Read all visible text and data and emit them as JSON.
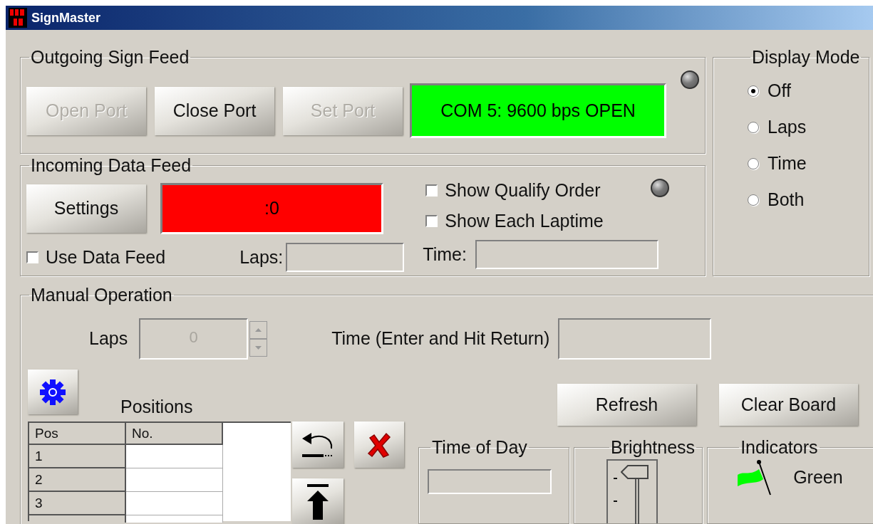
{
  "window": {
    "title": "SignMaster"
  },
  "outgoing_sign_feed": {
    "title": "Outgoing Sign Feed",
    "buttons": [
      {
        "label": "Open Port",
        "disabled": true
      },
      {
        "label": "Close Port",
        "disabled": false
      },
      {
        "label": "Set Port",
        "disabled": true
      }
    ],
    "status": {
      "text": "COM 5: 9600 bps OPEN",
      "alert": false
    },
    "led_lit": false
  },
  "incoming_data_feed": {
    "title": "Incoming Data Feed",
    "settings_button": "Settings",
    "status": {
      "text": ":0",
      "alert": true
    },
    "led_lit": false,
    "checkboxes": [
      {
        "label": "Show Qualify Order",
        "checked": false
      },
      {
        "label": "Show Each Laptime",
        "checked": false
      }
    ],
    "use_data_feed": {
      "label": "Use Data Feed",
      "checked": false
    },
    "laps_label": "Laps:",
    "time_label": "Time:"
  },
  "display_mode": {
    "title": "Display Mode",
    "options": [
      {
        "label": "Off",
        "selected": true
      },
      {
        "label": "Laps",
        "selected": false
      },
      {
        "label": "Time",
        "selected": false
      },
      {
        "label": "Both",
        "selected": false
      }
    ]
  },
  "manual_operation": {
    "title": "Manual Operation",
    "laps": {
      "label": "Laps",
      "value": "0",
      "disabled": true
    },
    "time_label": "Time (Enter and Hit Return)",
    "positions_label": "Positions",
    "table": {
      "columns": [
        "Pos",
        "No."
      ],
      "rows": [
        "1",
        "2",
        "3"
      ]
    },
    "refresh_button": "Refresh",
    "clear_board_button": "Clear Board",
    "time_of_day": {
      "title": "Time of Day"
    },
    "brightness": {
      "title": "Brightness"
    },
    "indicators": {
      "title": "Indicators",
      "flag": {
        "label": "Green",
        "color": "#00ff00"
      }
    }
  }
}
